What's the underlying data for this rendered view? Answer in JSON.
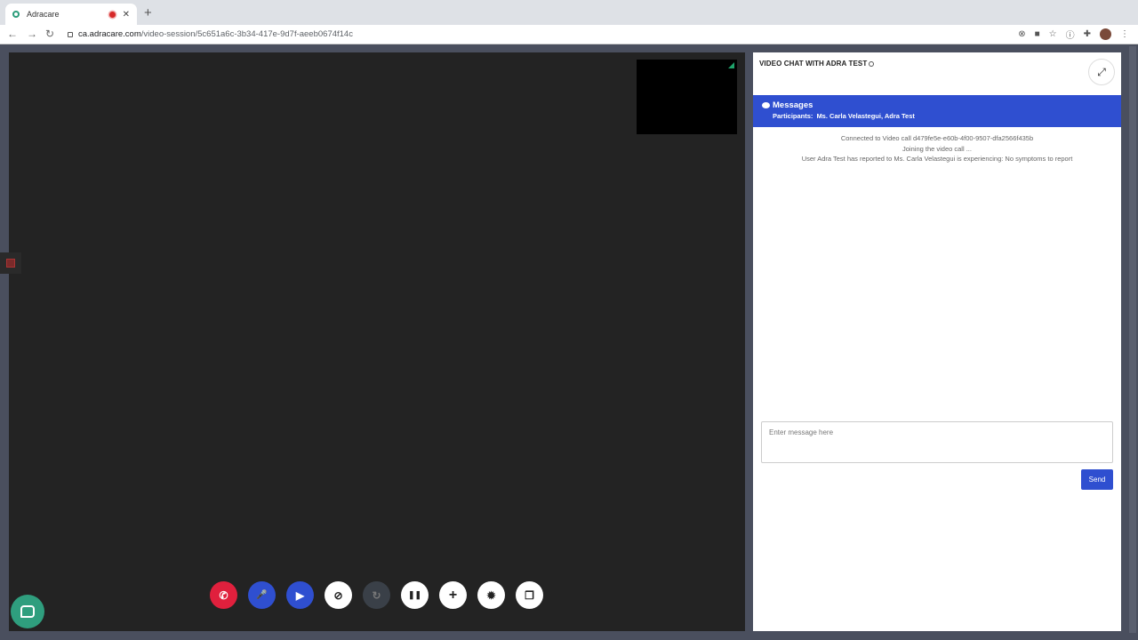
{
  "browser": {
    "tab_title": "Adracare",
    "tab_close": "✕",
    "new_tab": "+",
    "url_host": "ca.adracare.com",
    "url_path": "/video-session/5c651a6c-3b34-417e-9d7f-aeeb0674f14c",
    "back": "←",
    "forward": "→",
    "reload": "↻"
  },
  "controls": {
    "end_call": "✆",
    "mute_mic": "🎤",
    "toggle_camera": "▶",
    "attach": "⊘",
    "flip": "↻",
    "pause": "❚❚",
    "add": "+",
    "settings": "✹",
    "pip": "❐"
  },
  "chat": {
    "title": "VIDEO CHAT WITH ADRA TEST",
    "expand_icon": "⤢",
    "header": "Messages",
    "participants_label": "Participants:",
    "participants": "Ms. Carla Velastegui, Adra Test",
    "messages": [
      "Connected to Video call d479fe5e-e60b-4f00-9507-dfa2566f435b",
      "Joining the video call ...",
      "User Adra Test has reported to Ms. Carla Velastegui is experiencing: No symptoms to report"
    ],
    "input_placeholder": "Enter message here",
    "send_label": "Send"
  },
  "colors": {
    "accent": "#2f4fd0",
    "end_call": "#e0203d",
    "video_bg": "#232323"
  }
}
